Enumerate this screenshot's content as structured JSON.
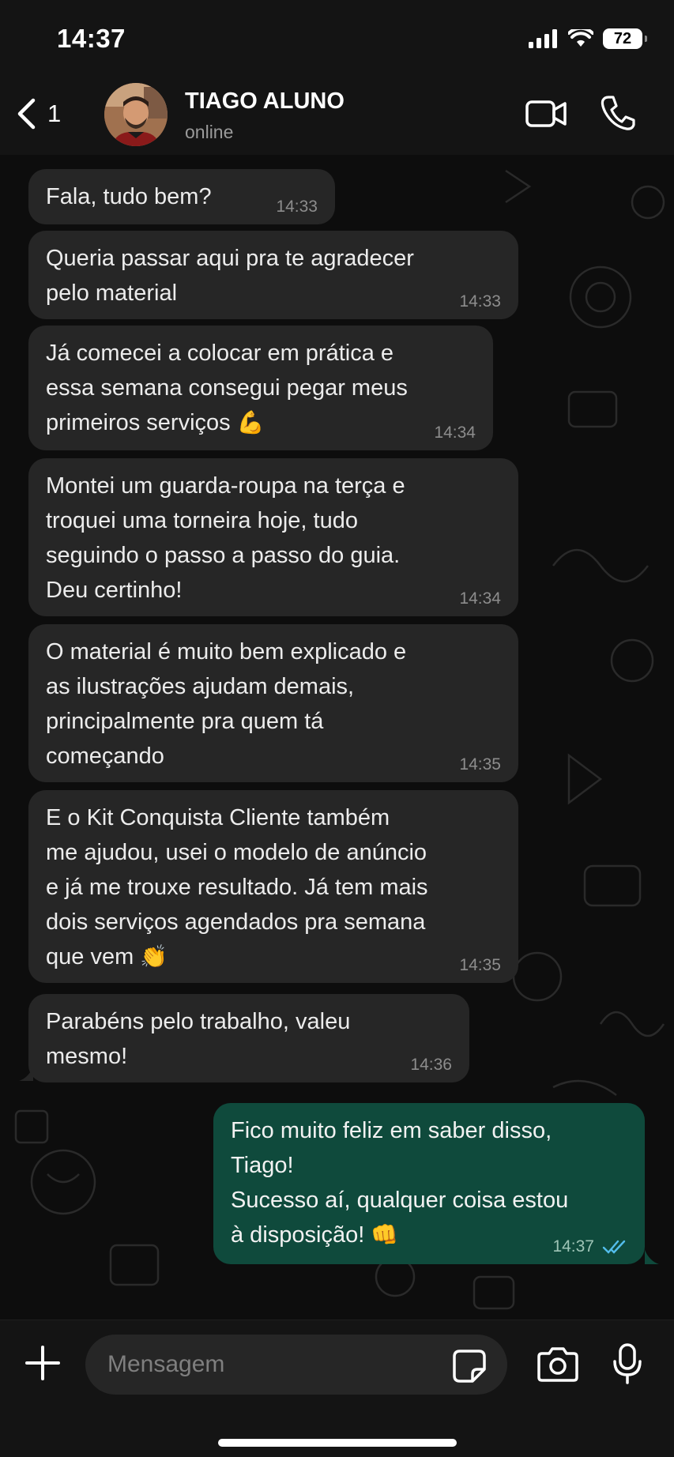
{
  "status_bar": {
    "time": "14:37",
    "battery": "72"
  },
  "header": {
    "back_count": "1",
    "contact_name": "TIAGO ALUNO",
    "contact_status": "online"
  },
  "messages": [
    {
      "direction": "in",
      "text": "Fala, tudo bem?",
      "time": "14:33"
    },
    {
      "direction": "in",
      "text": "Queria passar aqui pra te agradecer\npelo material",
      "time": "14:33"
    },
    {
      "direction": "in",
      "text": "Já comecei a colocar em prática e\nessa semana consegui pegar meus\nprimeiros serviços",
      "emoji": "💪",
      "time": "14:34"
    },
    {
      "direction": "in",
      "text": "Montei um guarda-roupa na terça e\ntroquei uma torneira hoje, tudo\nseguindo o passo a passo do guia.\nDeu certinho!",
      "time": "14:34"
    },
    {
      "direction": "in",
      "text": "O material é muito bem explicado e\nas ilustrações ajudam demais,\nprincipalmente pra quem tá\ncomeçando",
      "time": "14:35"
    },
    {
      "direction": "in",
      "text": "E o Kit Conquista Cliente também\nme ajudou, usei o modelo de anúncio\ne já me trouxe resultado. Já tem mais\ndois serviços agendados pra semana\nque vem",
      "emoji": "👏",
      "time": "14:35"
    },
    {
      "direction": "in",
      "text": "Parabéns pelo trabalho, valeu\nmesmo!",
      "time": "14:36"
    },
    {
      "direction": "out",
      "text": "Fico muito feliz em saber disso,\nTiago!\nSucesso aí, qualquer coisa estou\nà disposição!",
      "emoji": "👊",
      "time": "14:37",
      "read": true
    }
  ],
  "composer": {
    "placeholder": "Mensagem"
  },
  "colors": {
    "incoming_bubble": "#262626",
    "outgoing_bubble": "#0f4a3c",
    "read_ticks": "#53bdeb",
    "background": "#0d0d0d"
  },
  "icons": [
    "signal-icon",
    "wifi-icon",
    "battery-icon",
    "back-chevron-icon",
    "video-call-icon",
    "phone-call-icon",
    "plus-icon",
    "sticker-icon",
    "camera-icon",
    "microphone-icon",
    "read-ticks-icon"
  ]
}
